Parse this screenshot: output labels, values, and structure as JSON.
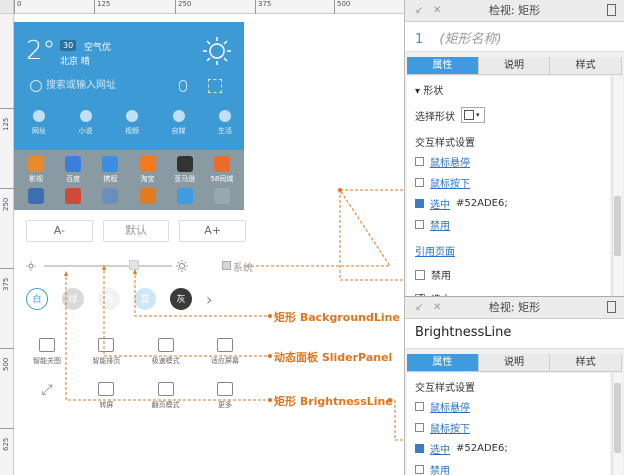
{
  "ruler": {
    "top": [
      "0",
      "125",
      "250",
      "375",
      "500"
    ],
    "left": [
      "125",
      "250",
      "375",
      "500",
      "625"
    ]
  },
  "weather": {
    "temperature": "2°",
    "aqi_badge": "30",
    "aqi_text": "空气优",
    "city": "北京 晴"
  },
  "search": {
    "placeholder": "搜索或输入网址"
  },
  "shortcuts": [
    "网址",
    "小说",
    "视频",
    "自媒",
    "生活"
  ],
  "apps": [
    {
      "label": "影视",
      "color": "#e88a2b"
    },
    {
      "label": "百度",
      "color": "#3c7de0"
    },
    {
      "label": "携程",
      "color": "#3c8ee0"
    },
    {
      "label": "淘宝",
      "color": "#f07a1c"
    },
    {
      "label": "亚马逊",
      "color": "#333333"
    },
    {
      "label": "58同城",
      "color": "#ea6b2a"
    }
  ],
  "slider_panel": {
    "font_buttons": [
      "A-",
      "默认",
      "A+"
    ],
    "system_label": "系统",
    "brightness_level": 0.7,
    "colors": [
      {
        "label": "白",
        "bg": "#ffffff",
        "fg": "#3a9ad9",
        "border": "#3a9ad9"
      },
      {
        "label": "绿",
        "bg": "#d9d9d9",
        "fg": "#ffffff",
        "border": "#d9d9d9"
      },
      {
        "label": "粉",
        "bg": "#f2f2f2",
        "fg": "#ffffff",
        "border": "#f2f2f2"
      },
      {
        "label": "蓝",
        "bg": "#cde7f7",
        "fg": "#ffffff",
        "border": "#cde7f7"
      },
      {
        "label": "灰",
        "bg": "#3a3a3a",
        "fg": "#ffffff",
        "border": "#3a3a3a"
      }
    ],
    "more": "›",
    "tools_row1": [
      "智能关图",
      "智能排页",
      "极速模式",
      "适应屏幕"
    ],
    "tools_row2": [
      "",
      "转屏",
      "翻页模式",
      "更多"
    ]
  },
  "annotations": {
    "background_line": "矩形 BackgroundLine",
    "slider_panel": "动态面板 SliderPanel",
    "brightness_line": "矩形 BrightnessLine"
  },
  "inspector1": {
    "title": "检视: 矩形",
    "number": "1",
    "name_placeholder": "(矩形名称)",
    "tabs": [
      "属性",
      "说明",
      "样式"
    ],
    "shape_section": "形状",
    "select_shape": "选择形状",
    "interaction_styles": "交互样式设置",
    "mouse_over": "鼠标悬停",
    "mouse_down": "鼠标按下",
    "selected": "选中",
    "selected_value": "#52ADE6;",
    "disabled": "禁用",
    "ref_page": "引用页面",
    "disable_check": "禁用",
    "select_check": "选中"
  },
  "inspector2": {
    "title": "检视: 矩形",
    "name": "BrightnessLine",
    "tabs": [
      "属性",
      "说明",
      "样式"
    ],
    "interaction_styles": "交互样式设置",
    "mouse_over": "鼠标悬停",
    "mouse_down": "鼠标按下",
    "selected": "选中",
    "selected_value": "#52ADE6;",
    "disabled": "禁用"
  }
}
